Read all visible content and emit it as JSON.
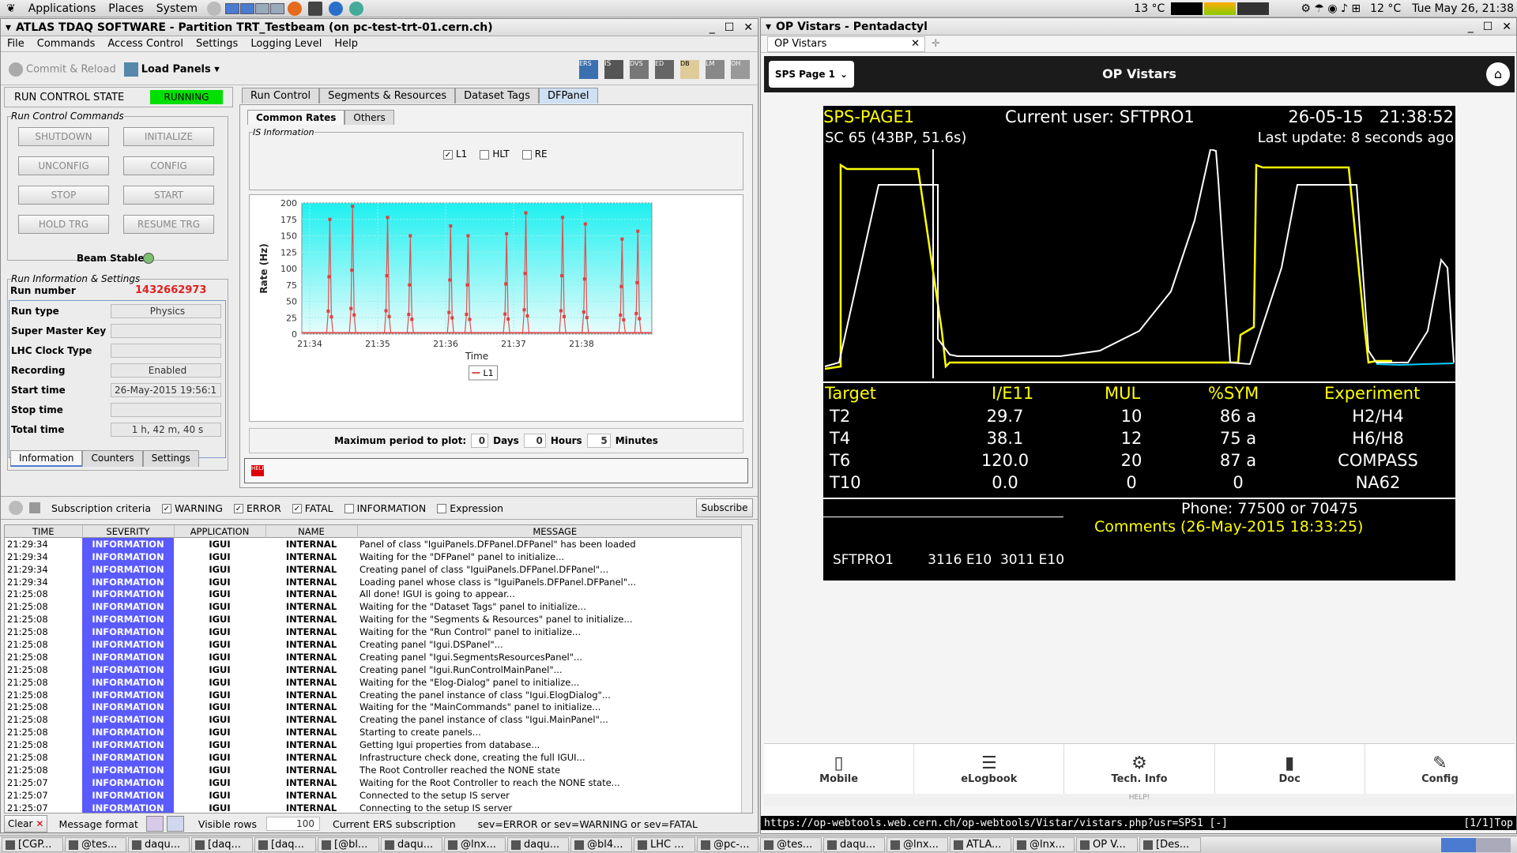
{
  "top": {
    "applications": "Applications",
    "places": "Places",
    "system": "System",
    "temp1": "13 °C",
    "temp2": "12 °C",
    "datetime": "Tue May 26, 21:38"
  },
  "atlas": {
    "title": "ATLAS TDAQ SOFTWARE - Partition TRT_Testbeam (on pc-test-trt-01.cern.ch)",
    "menu": [
      "File",
      "Commands",
      "Access Control",
      "Settings",
      "Logging Level",
      "Help"
    ],
    "commit": "Commit & Reload",
    "load_panels": "Load Panels",
    "rc_state_label": "RUN CONTROL STATE",
    "rc_state": "RUNNING",
    "rc_commands_legend": "Run Control Commands",
    "cmds": [
      "SHUTDOWN",
      "INITIALIZE",
      "UNCONFIG",
      "CONFIG",
      "STOP",
      "START",
      "HOLD TRG",
      "RESUME TRG"
    ],
    "beam_stable": "Beam Stable",
    "run_info_legend": "Run Information & Settings",
    "run_number_label": "Run number",
    "run_number": "1432662973",
    "info": [
      {
        "k": "Run type",
        "v": "Physics"
      },
      {
        "k": "Super Master Key",
        "v": ""
      },
      {
        "k": "LHC Clock Type",
        "v": ""
      },
      {
        "k": "Recording",
        "v": "Enabled"
      },
      {
        "k": "Start time",
        "v": "26-May-2015 19:56:1"
      },
      {
        "k": "Stop time",
        "v": ""
      },
      {
        "k": "Total time",
        "v": "1 h, 42 m, 40 s"
      }
    ],
    "left_tabs": [
      "Information",
      "Counters",
      "Settings"
    ],
    "main_tabs": [
      "Run Control",
      "Segments & Resources",
      "Dataset Tags",
      "DFPanel"
    ],
    "sub_tabs": [
      "Common Rates",
      "Others"
    ],
    "is_legend": "IS Information",
    "checks": [
      "L1",
      "HLT",
      "RE"
    ],
    "legend_item": "L1",
    "period_label": "Maximum period to plot:",
    "days": "0",
    "days_l": "Days",
    "hours": "0",
    "hours_l": "Hours",
    "minutes": "5",
    "minutes_l": "Minutes",
    "sub_bar": {
      "criteria": "Subscription criteria",
      "warning": "WARNING",
      "error": "ERROR",
      "fatal": "FATAL",
      "information": "INFORMATION",
      "expression": "Expression",
      "subscribe": "Subscribe"
    },
    "log_headers": [
      "TIME",
      "SEVERITY",
      "APPLICATION",
      "NAME",
      "MESSAGE"
    ],
    "log_rows": [
      [
        "21:29:34",
        "INFORMATION",
        "IGUI",
        "INTERNAL",
        "Panel of class \"IguiPanels.DFPanel.DFPanel\" has been loaded"
      ],
      [
        "21:29:34",
        "INFORMATION",
        "IGUI",
        "INTERNAL",
        "Waiting for the \"DFPanel\" panel to initialize..."
      ],
      [
        "21:29:34",
        "INFORMATION",
        "IGUI",
        "INTERNAL",
        "Creating panel of class \"IguiPanels.DFPanel.DFPanel\"..."
      ],
      [
        "21:29:34",
        "INFORMATION",
        "IGUI",
        "INTERNAL",
        "Loading panel whose class is \"IguiPanels.DFPanel.DFPanel\"..."
      ],
      [
        "21:25:08",
        "INFORMATION",
        "IGUI",
        "INTERNAL",
        "All done! IGUI is going to appear..."
      ],
      [
        "21:25:08",
        "INFORMATION",
        "IGUI",
        "INTERNAL",
        "Waiting for the \"Dataset Tags\" panel to initialize..."
      ],
      [
        "21:25:08",
        "INFORMATION",
        "IGUI",
        "INTERNAL",
        "Waiting for the \"Segments & Resources\" panel to initialize..."
      ],
      [
        "21:25:08",
        "INFORMATION",
        "IGUI",
        "INTERNAL",
        "Waiting for the \"Run Control\" panel to initialize..."
      ],
      [
        "21:25:08",
        "INFORMATION",
        "IGUI",
        "INTERNAL",
        "Creating panel \"Igui.DSPanel\"..."
      ],
      [
        "21:25:08",
        "INFORMATION",
        "IGUI",
        "INTERNAL",
        "Creating panel \"Igui.SegmentsResourcesPanel\"..."
      ],
      [
        "21:25:08",
        "INFORMATION",
        "IGUI",
        "INTERNAL",
        "Creating panel \"Igui.RunControlMainPanel\"..."
      ],
      [
        "21:25:08",
        "INFORMATION",
        "IGUI",
        "INTERNAL",
        "Waiting for the \"Elog-Dialog\" panel to initialize..."
      ],
      [
        "21:25:08",
        "INFORMATION",
        "IGUI",
        "INTERNAL",
        "Creating the panel instance of class \"Igui.ElogDialog\"..."
      ],
      [
        "21:25:08",
        "INFORMATION",
        "IGUI",
        "INTERNAL",
        "Waiting for the \"MainCommands\" panel to initialize..."
      ],
      [
        "21:25:08",
        "INFORMATION",
        "IGUI",
        "INTERNAL",
        "Creating the panel instance of class \"Igui.MainPanel\"..."
      ],
      [
        "21:25:08",
        "INFORMATION",
        "IGUI",
        "INTERNAL",
        "Starting to create panels..."
      ],
      [
        "21:25:08",
        "INFORMATION",
        "IGUI",
        "INTERNAL",
        "Getting Igui properties from database..."
      ],
      [
        "21:25:08",
        "INFORMATION",
        "IGUI",
        "INTERNAL",
        "Infrastructure check done, creating the full IGUI..."
      ],
      [
        "21:25:08",
        "INFORMATION",
        "IGUI",
        "INTERNAL",
        "The Root Controller reached the NONE state"
      ],
      [
        "21:25:07",
        "INFORMATION",
        "IGUI",
        "INTERNAL",
        "Waiting for the Root Controller to reach the NONE state..."
      ],
      [
        "21:25:07",
        "INFORMATION",
        "IGUI",
        "INTERNAL",
        "Connected to the setup IS server"
      ],
      [
        "21:25:07",
        "INFORMATION",
        "IGUI",
        "INTERNAL",
        "Connecting to the setup IS server"
      ]
    ],
    "bottom": {
      "clear": "Clear",
      "msg_format": "Message format",
      "visible_rows": "Visible rows",
      "rows_value": "100",
      "current_sub": "Current ERS subscription",
      "sub_value": "sev=ERROR or sev=WARNING or sev=FATAL"
    }
  },
  "chart_data": {
    "type": "line",
    "xlabel": "Time",
    "ylabel": "Rate (Hz)",
    "ylim": [
      0,
      200
    ],
    "yticks": [
      "0",
      "25",
      "50",
      "75",
      "100",
      "125",
      "150",
      "175",
      "200"
    ],
    "xticks": [
      "21:34",
      "21:35",
      "21:36",
      "21:37",
      "21:38"
    ],
    "legend": "L1",
    "bursts": [
      [
        0.08,
        175
      ],
      [
        0.145,
        195
      ],
      [
        0.245,
        178
      ],
      [
        0.31,
        150
      ],
      [
        0.425,
        165
      ],
      [
        0.475,
        150
      ],
      [
        0.585,
        153
      ],
      [
        0.64,
        185
      ],
      [
        0.745,
        178
      ],
      [
        0.81,
        168
      ],
      [
        0.915,
        145
      ],
      [
        0.96,
        157
      ]
    ]
  },
  "browser": {
    "title": "OP Vistars - Pentadactyl",
    "tab": "OP Vistars",
    "page_btn": "SPS Page 1",
    "header": "OP Vistars",
    "status_url": "https://op-webtools.web.cern.ch/op-webtools/Vistar/vistars.php?usr=SPS1 [-]",
    "status_pos": "[1/1]Top",
    "nav": [
      "Mobile",
      "eLogbook",
      "Tech. Info",
      "Doc",
      "Config"
    ],
    "help": "HELP!"
  },
  "vistar": {
    "page": "SPS-PAGE1",
    "user": "Current user: SFTPRO1",
    "datetime": "26-05-15   21:38:52",
    "sc": "SC 65 (43BP, 51.6s)",
    "update": "Last update: 8 seconds ago",
    "headers": [
      "Target",
      "I/E11",
      "MUL",
      "%SYM",
      "Experiment"
    ],
    "rows": [
      [
        "T2",
        "29.7",
        "10",
        "86 a",
        "H2/H4"
      ],
      [
        "T4",
        "38.1",
        "12",
        "75 a",
        "H6/H8"
      ],
      [
        "T6",
        "120.0",
        "20",
        "87 a",
        "COMPASS"
      ],
      [
        "T10",
        "0.0",
        "0",
        "0",
        "NA62"
      ]
    ],
    "phone": "Phone: 77500 or 70475",
    "comments": "Comments (26-May-2015 18:33:25)",
    "footer": "SFTPRO1        3116 E10  3011 E10"
  },
  "taskbar": [
    "[CGP...",
    "@tes...",
    "daqu...",
    "[daq...",
    "[daq...",
    "[@bl...",
    "daqu...",
    "@lnx...",
    "daqu...",
    "@bl4...",
    "LHC ...",
    "@pc-...",
    "@tes...",
    "daqu...",
    "@lnx...",
    "ATLA...",
    "@lnx...",
    "OP V...",
    "[Des..."
  ]
}
